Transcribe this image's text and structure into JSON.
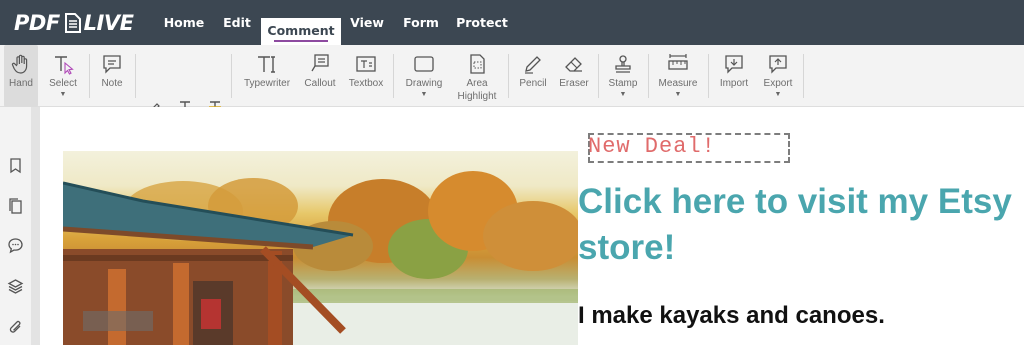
{
  "app": {
    "logo_prefix": "PDF",
    "logo_suffix": "LIVE"
  },
  "nav": {
    "items": [
      {
        "label": "Home"
      },
      {
        "label": "Edit"
      },
      {
        "label": "Comment",
        "active": true
      },
      {
        "label": "View"
      },
      {
        "label": "Form"
      },
      {
        "label": "Protect"
      }
    ]
  },
  "toolbar": {
    "hand": "Hand",
    "select": "Select",
    "note": "Note",
    "typewriter": "Typewriter",
    "callout": "Callout",
    "textbox": "Textbox",
    "drawing": "Drawing",
    "area_highlight_1": "Area",
    "area_highlight_2": "Highlight",
    "pencil": "Pencil",
    "eraser": "Eraser",
    "stamp": "Stamp",
    "measure": "Measure",
    "import": "Import",
    "export": "Export"
  },
  "sidebar": {
    "icons": [
      "bookmark-icon",
      "pages-icon",
      "comments-icon",
      "layers-icon",
      "attachment-icon"
    ]
  },
  "document": {
    "stamp_text": "New Deal!",
    "headline_line1": "Click here to visit my Etsy",
    "headline_line2": "store!",
    "subtext": "I make kayaks and canoes."
  },
  "colors": {
    "topbar": "#3c4752",
    "active_underline": "#8d4aa0",
    "headline": "#4aa6ae",
    "stamp": "#e06b6b"
  }
}
